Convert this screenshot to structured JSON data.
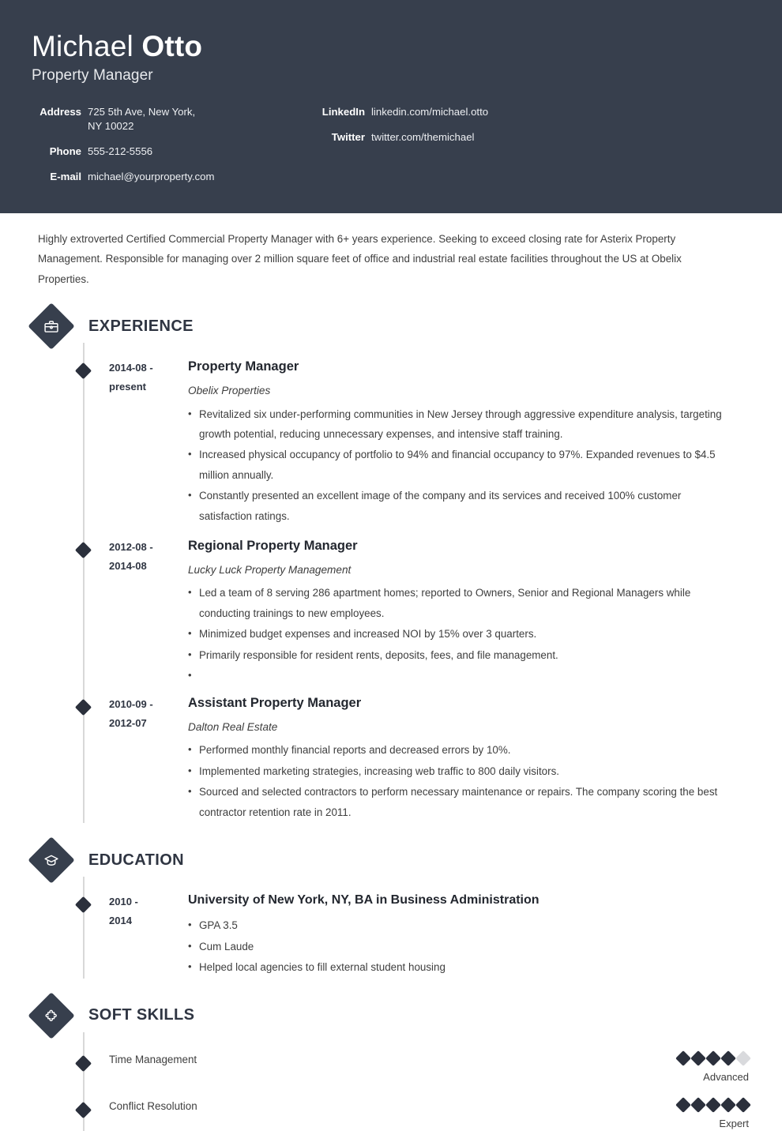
{
  "header": {
    "first_name": "Michael ",
    "last_name": "Otto",
    "job_title": "Property Manager",
    "contacts_left": [
      {
        "label": "Address",
        "value": "725 5th Ave, New York,",
        "value2": "NY 10022"
      },
      {
        "label": "Phone",
        "value": "555-212-5556"
      },
      {
        "label": "E-mail",
        "value": "michael@yourproperty.com"
      }
    ],
    "contacts_right": [
      {
        "label": "LinkedIn",
        "value": "linkedin.com/michael.otto"
      },
      {
        "label": "Twitter",
        "value": "twitter.com/themichael"
      }
    ],
    "background_color": "#373f4d"
  },
  "summary": "Highly extroverted Certified Commercial Property Manager with 6+ years experience. Seeking to exceed closing rate for Asterix Property Management. Responsible for managing over 2 million square feet of office and industrial real estate facilities throughout the US at Obelix Properties.",
  "experience": {
    "title": "EXPERIENCE",
    "icon": "briefcase-icon",
    "entries": [
      {
        "date_from": "2014-08 -",
        "date_to": "present",
        "role": "Property Manager",
        "company": "Obelix Properties",
        "bullets": [
          "Revitalized six under-performing communities in New Jersey through aggressive expenditure analysis, targeting growth potential, reducing unnecessary expenses, and intensive staff training.",
          "Increased physical occupancy of portfolio to 94% and financial occupancy to 97%. Expanded revenues to $4.5 million annually.",
          "Constantly presented an excellent image of the company and its services and received 100% customer satisfaction ratings."
        ]
      },
      {
        "date_from": "2012-08 -",
        "date_to": "2014-08",
        "role": "Regional Property Manager",
        "company": "Lucky Luck Property Management",
        "bullets": [
          "Led a team of 8 serving 286 apartment homes; reported to Owners, Senior and Regional Managers while conducting trainings to new employees.",
          "Minimized budget expenses and increased NOI by 15% over 3 quarters.",
          "Primarily responsible for resident rents, deposits, fees, and file management.",
          ""
        ]
      },
      {
        "date_from": "2010-09 -",
        "date_to": "2012-07",
        "role": "Assistant Property Manager",
        "company": "Dalton Real Estate",
        "bullets": [
          "Performed monthly financial reports and decreased errors by 10%.",
          "Implemented marketing strategies, increasing web traffic to 800 daily visitors.",
          "Sourced and selected contractors to perform necessary maintenance or repairs. The company scoring the best contractor retention rate in 2011."
        ]
      }
    ]
  },
  "education": {
    "title": "EDUCATION",
    "icon": "graduation-cap-icon",
    "entries": [
      {
        "date_from": "2010 -",
        "date_to": "2014",
        "degree": "University of New York, NY, BA in Business Administration",
        "bullets": [
          "GPA 3.5",
          "Cum Laude",
          "Helped local agencies to fill external student housing"
        ]
      }
    ]
  },
  "soft_skills": {
    "title": "SOFT SKILLS",
    "icon": "puzzle-piece-icon",
    "max_rating": 5,
    "items": [
      {
        "name": "Time Management",
        "rating": 4,
        "level": "Advanced"
      },
      {
        "name": "Conflict Resolution",
        "rating": 5,
        "level": "Expert"
      }
    ]
  }
}
